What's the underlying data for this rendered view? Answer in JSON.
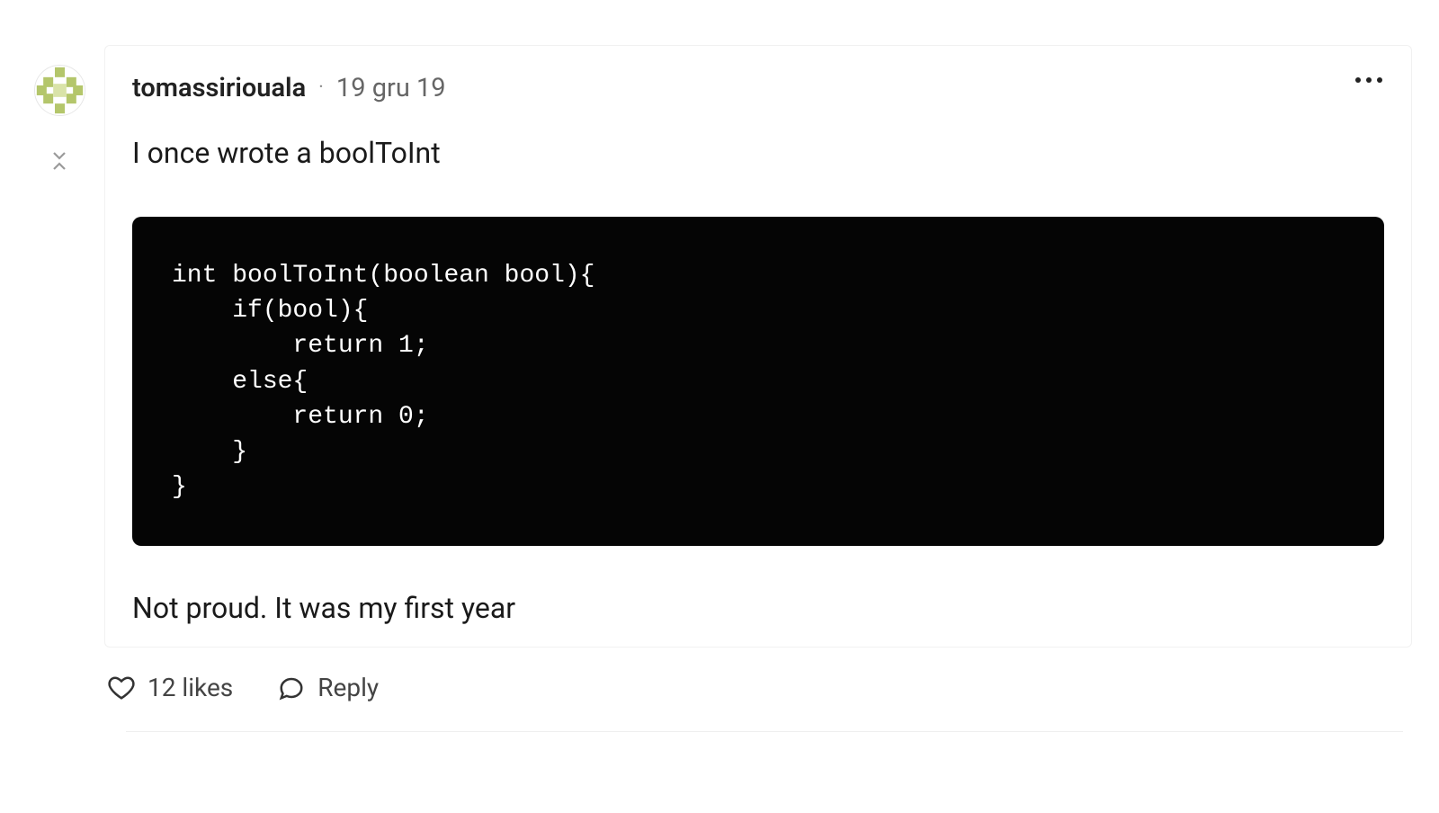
{
  "comment": {
    "username": "tomassiriouala",
    "separator": "·",
    "timestamp": "19 gru 19",
    "body_line_1": "I once wrote a boolToInt",
    "code": "int boolToInt(boolean bool){\n    if(bool){\n        return 1;\n    else{\n        return 0;\n    }\n}",
    "body_line_2": "Not proud. It was my first year"
  },
  "actions": {
    "likes_label": "12 likes",
    "reply_label": "Reply"
  }
}
